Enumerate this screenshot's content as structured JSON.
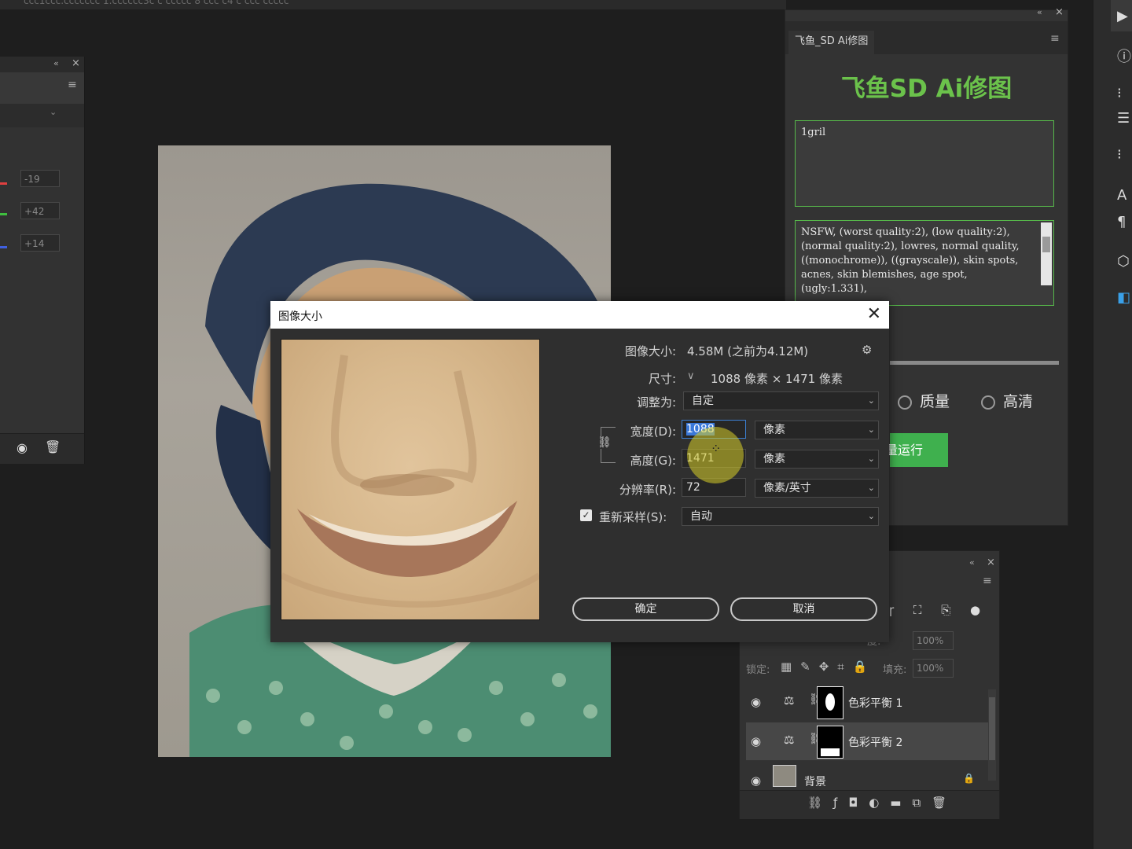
{
  "topbar": {
    "text": "ccc1ccc.ccccccc 1.cccccc3c c ccccc 8 ccc c4 c ccc ccccc"
  },
  "left_panel": {
    "values": [
      "-19",
      "+42",
      "+14"
    ],
    "colors": [
      "#e04040",
      "#3fbf3f",
      "#4060e0"
    ]
  },
  "ai_panel": {
    "tab_label": "飞鱼_SD Ai修图",
    "title": "飞鱼SD Ai修图",
    "prompt_text": "1gril",
    "negative_text": "NSFW, (worst quality:2), (low quality:2), (normal quality:2), lowres, normal quality, ((monochrome)), ((grayscale)), skin spots, acnes, skin blemishes, age spot, (ugly:1.331),",
    "radio_quality": "质量",
    "radio_hd": "高清",
    "run_button": "量运行",
    "accent_color": "#6bc24b"
  },
  "dialog": {
    "title": "图像大小",
    "image_size_label": "图像大小:",
    "image_size_value": "4.58M (之前为4.12M)",
    "dimensions_label": "尺寸:",
    "dimensions_value": "1088 像素  ×  1471 像素",
    "fit_to_label": "调整为:",
    "fit_to_value": "自定",
    "width_label": "宽度(D):",
    "width_value": "1088",
    "width_unit": "像素",
    "height_label": "高度(G):",
    "height_value": "1471",
    "height_unit": "像素",
    "resolution_label": "分辨率(R):",
    "resolution_value": "72",
    "resolution_unit": "像素/英寸",
    "resample_label": "重新采样(S):",
    "resample_checked": true,
    "resample_value": "自动",
    "ok_button": "确定",
    "cancel_button": "取消"
  },
  "layers": {
    "opacity_label": "度:",
    "opacity_value": "100%",
    "lock_label": "锁定:",
    "fill_label": "填充:",
    "fill_value": "100%",
    "rows": [
      {
        "name": "色彩平衡 1"
      },
      {
        "name": "色彩平衡 2"
      },
      {
        "name": "背景"
      }
    ]
  }
}
